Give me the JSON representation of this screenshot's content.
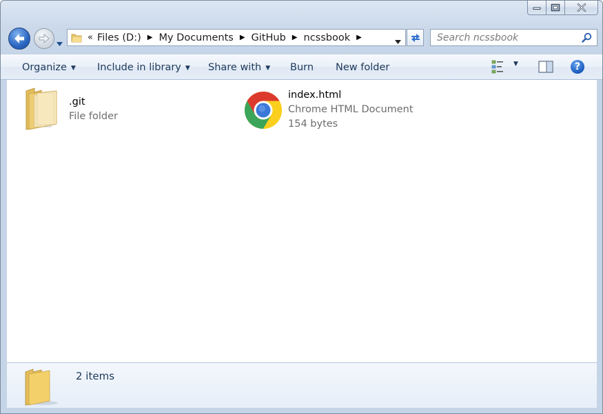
{
  "window": {
    "caption": {
      "minimize": "minimize-icon",
      "maximize": "maximize-icon",
      "close": "close-icon"
    }
  },
  "nav": {
    "back": "back-arrow-icon",
    "forward": "forward-arrow-icon",
    "breadcrumb_overflow": "«",
    "breadcrumb": [
      "Files (D:)",
      "My Documents",
      "GitHub",
      "ncssbook"
    ]
  },
  "search": {
    "placeholder": "Search ncssbook"
  },
  "toolbar": {
    "organize": "Organize",
    "include_in_library": "Include in library",
    "share_with": "Share with",
    "burn": "Burn",
    "new_folder": "New folder",
    "help": "?"
  },
  "files": [
    {
      "name": ".git",
      "type": "File folder",
      "icon": "folder-icon"
    },
    {
      "name": "index.html",
      "type": "Chrome HTML Document",
      "size": "154 bytes",
      "icon": "chrome-icon"
    }
  ],
  "details": {
    "count": "2 items"
  },
  "colors": {
    "toolbar_text": "#1e395b",
    "meta_text": "#6d6d6d",
    "frame": "#c5d5e8"
  }
}
